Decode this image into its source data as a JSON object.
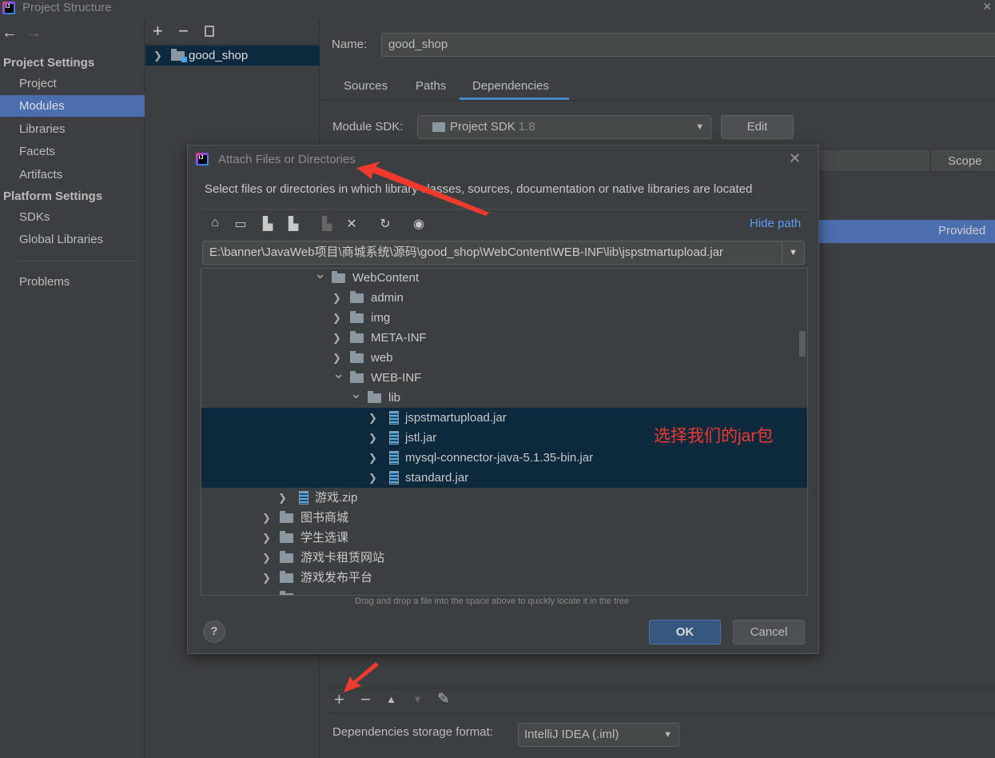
{
  "window": {
    "title": "Project Structure",
    "close": "×"
  },
  "nav": {
    "back": "←",
    "forward": "→"
  },
  "sidebar": {
    "project_settings": "Project Settings",
    "items": [
      {
        "label": "Project"
      },
      {
        "label": "Modules",
        "selected": true
      },
      {
        "label": "Libraries"
      },
      {
        "label": "Facets"
      },
      {
        "label": "Artifacts"
      }
    ],
    "platform_settings": "Platform Settings",
    "platform_items": [
      {
        "label": "SDKs"
      },
      {
        "label": "Global Libraries"
      }
    ],
    "problems": "Problems"
  },
  "modules": {
    "add": "+",
    "remove": "−",
    "module": "good_shop"
  },
  "main": {
    "name_label": "Name:",
    "name_value": "good_shop",
    "tabs": [
      {
        "label": "Sources"
      },
      {
        "label": "Paths"
      },
      {
        "label": "Dependencies",
        "active": true
      }
    ],
    "sdk_label": "Module SDK:",
    "sdk_value": "Project SDK",
    "sdk_version": "1.8",
    "edit": "Edit",
    "scope_header": "Scope",
    "row_scope": "Provided",
    "toolbar": {
      "add": "+",
      "remove": "−",
      "up": "▲",
      "down": "▼",
      "edit": "✎"
    },
    "storage_label": "Dependencies storage format:",
    "storage_value": "IntelliJ IDEA (.iml)"
  },
  "dialog": {
    "title": "Attach Files or Directories",
    "close": "✕",
    "description": "Select files or directories in which library classes, sources, documentation or native libraries are located",
    "hide_path": "Hide path",
    "path": "E:\\banner\\JavaWeb项目\\商城系统\\源码\\good_shop\\WebContent\\WEB-INF\\lib\\jspstmartupload.jar",
    "tree": [
      {
        "label": "WebContent",
        "type": "folder",
        "level": 0,
        "expanded": true
      },
      {
        "label": "admin",
        "type": "folder",
        "level": 1
      },
      {
        "label": "img",
        "type": "folder",
        "level": 1
      },
      {
        "label": "META-INF",
        "type": "folder",
        "level": 1
      },
      {
        "label": "web",
        "type": "folder",
        "level": 1
      },
      {
        "label": "WEB-INF",
        "type": "folder",
        "level": 1,
        "expanded": true
      },
      {
        "label": "lib",
        "type": "folder",
        "level": 2,
        "expanded": true
      },
      {
        "label": "jspstmartupload.jar",
        "type": "jar",
        "level": 3,
        "selected": true
      },
      {
        "label": "jstl.jar",
        "type": "jar",
        "level": 3,
        "selected": true
      },
      {
        "label": "mysql-connector-java-5.1.35-bin.jar",
        "type": "jar",
        "level": 3,
        "selected": true
      },
      {
        "label": "standard.jar",
        "type": "jar",
        "level": 3,
        "selected": true
      },
      {
        "label": "游戏.zip",
        "type": "jar",
        "level": -1
      },
      {
        "label": "图书商城",
        "type": "folder",
        "level": -2
      },
      {
        "label": "学生选课",
        "type": "folder",
        "level": -2
      },
      {
        "label": "游戏卡租赁网站",
        "type": "folder",
        "level": -2
      },
      {
        "label": "游戏发布平台",
        "type": "folder",
        "level": -2
      }
    ],
    "hint": "Drag and drop a file into the space above to quickly locate it in the tree",
    "help": "?",
    "ok": "OK",
    "cancel": "Cancel"
  },
  "annotation": {
    "text": "选择我们的jar包",
    "color": "#f03a2e"
  },
  "colors": {
    "background": "#3c3f41",
    "selection": "#4b6eaf",
    "tree_selection": "#0d293e",
    "link": "#589df6",
    "ok": "#365880"
  }
}
